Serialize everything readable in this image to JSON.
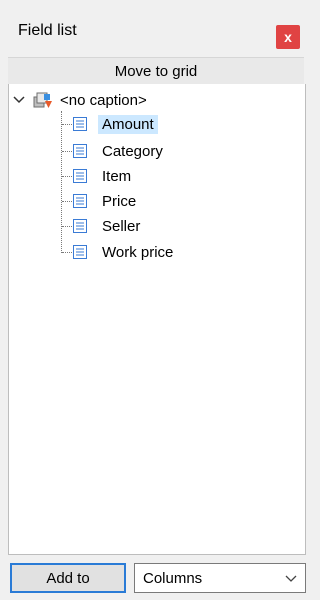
{
  "window": {
    "title": "Field list",
    "close_label": "x"
  },
  "move_to_grid": "Move to grid",
  "tree": {
    "root_label": "<no caption>",
    "items": [
      {
        "label": "Amount",
        "selected": true
      },
      {
        "label": "Category",
        "selected": false
      },
      {
        "label": "Item",
        "selected": false
      },
      {
        "label": "Price",
        "selected": false
      },
      {
        "label": "Seller",
        "selected": false
      },
      {
        "label": "Work price",
        "selected": false
      }
    ]
  },
  "footer": {
    "add_button": "Add to",
    "area_select_value": "Columns"
  },
  "icons": {
    "expand": "chevron-down-icon",
    "root": "cube-icon",
    "field": "document-icon",
    "close": "close-icon"
  },
  "colors": {
    "accent": "#2a7bd6",
    "selection": "#cce8ff",
    "close_bg": "#e04343"
  }
}
